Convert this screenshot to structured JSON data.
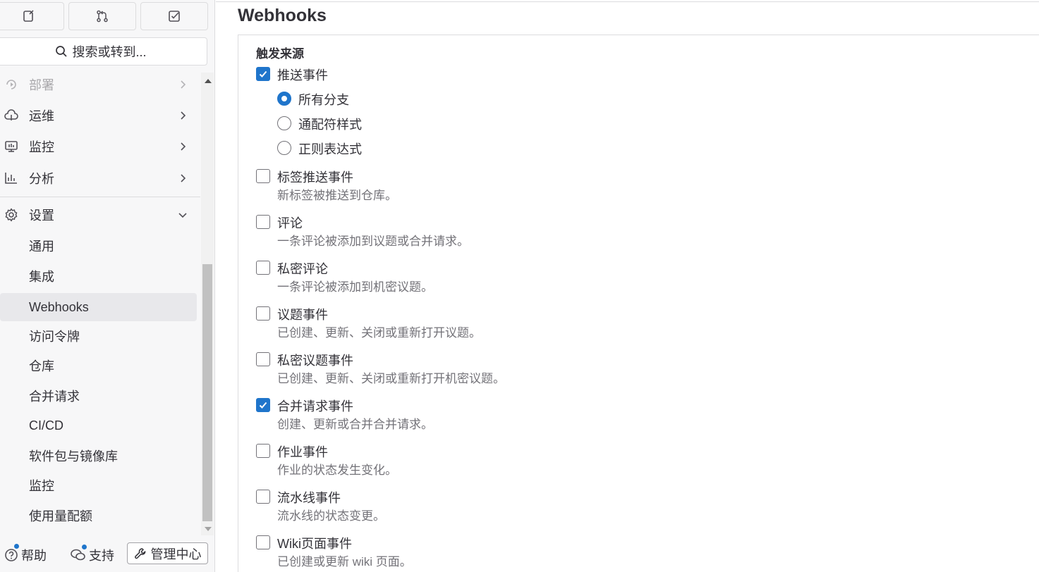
{
  "sidebar": {
    "top_buttons": [
      {
        "icon": "issues-icon"
      },
      {
        "icon": "merge-request-icon"
      },
      {
        "icon": "todo-icon"
      }
    ],
    "search_label": "搜索或转到...",
    "nav": {
      "deploy": "部署",
      "operate": "运维",
      "monitor": "监控",
      "analyze": "分析",
      "settings": "设置",
      "sub": {
        "general": "通用",
        "integrations": "集成",
        "webhooks": "Webhooks",
        "access_tokens": "访问令牌",
        "repository": "仓库",
        "merge_requests": "合并请求",
        "cicd": "CI/CD",
        "packages": "软件包与镜像库",
        "monitor": "监控",
        "usage_quotas": "使用量配额"
      }
    },
    "footer": {
      "help": "帮助",
      "support": "支持",
      "admin": "管理中心"
    }
  },
  "main": {
    "title": "Webhooks",
    "trigger_label": "触发来源",
    "push_events": {
      "label": "推送事件",
      "checked": true,
      "options": [
        "所有分支",
        "通配符样式",
        "正则表达式"
      ],
      "selected": "所有分支"
    },
    "triggers": [
      {
        "label": "标签推送事件",
        "help": "新标签被推送到仓库。",
        "checked": false
      },
      {
        "label": "评论",
        "help": "一条评论被添加到议题或合并请求。",
        "checked": false
      },
      {
        "label": "私密评论",
        "help": "一条评论被添加到机密议题。",
        "checked": false
      },
      {
        "label": "议题事件",
        "help": "已创建、更新、关闭或重新打开议题。",
        "checked": false
      },
      {
        "label": "私密议题事件",
        "help": "已创建、更新、关闭或重新打开机密议题。",
        "checked": false
      },
      {
        "label": "合并请求事件",
        "help": "创建、更新或合并合并请求。",
        "checked": true
      },
      {
        "label": "作业事件",
        "help": "作业的状态发生变化。",
        "checked": false
      },
      {
        "label": "流水线事件",
        "help": "流水线的状态变更。",
        "checked": false
      },
      {
        "label": "Wiki页面事件",
        "help": "已创建或更新 wiki 页面。",
        "checked": false
      }
    ]
  },
  "colors": {
    "accent": "#1f75cb",
    "text": "#333238",
    "muted": "#737278",
    "sidebar_bg": "#f7f7f8",
    "active_bg": "#e8e8eb"
  }
}
